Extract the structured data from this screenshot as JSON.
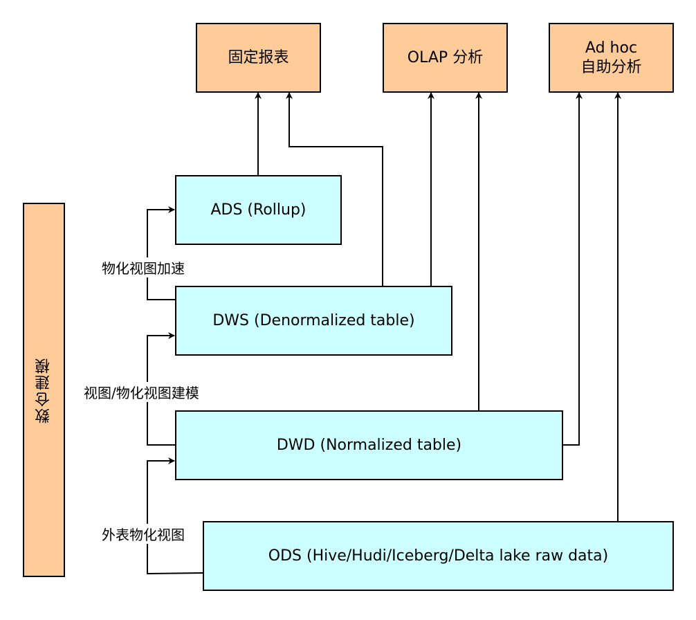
{
  "targets": {
    "fixed_report": "固定报表",
    "olap": "OLAP 分析",
    "adhoc": "Ad hoc\n自助分析"
  },
  "layers": {
    "ads": "ADS (Rollup)",
    "dws": "DWS (Denormalized table)",
    "dwd": "DWD (Normalized table)",
    "ods": "ODS (Hive/Hudi/Iceberg/Delta lake raw data)"
  },
  "side_label": "数仓建模",
  "edge_labels": {
    "dws_to_ads": "物化视图加速",
    "dwd_to_dws": "视图/物化视图建模",
    "ods_to_dwd": "外表物化视图"
  },
  "colors": {
    "target_fill": "#ffcc99",
    "layer_fill": "#ccffff",
    "side_fill": "#ffcc99"
  }
}
